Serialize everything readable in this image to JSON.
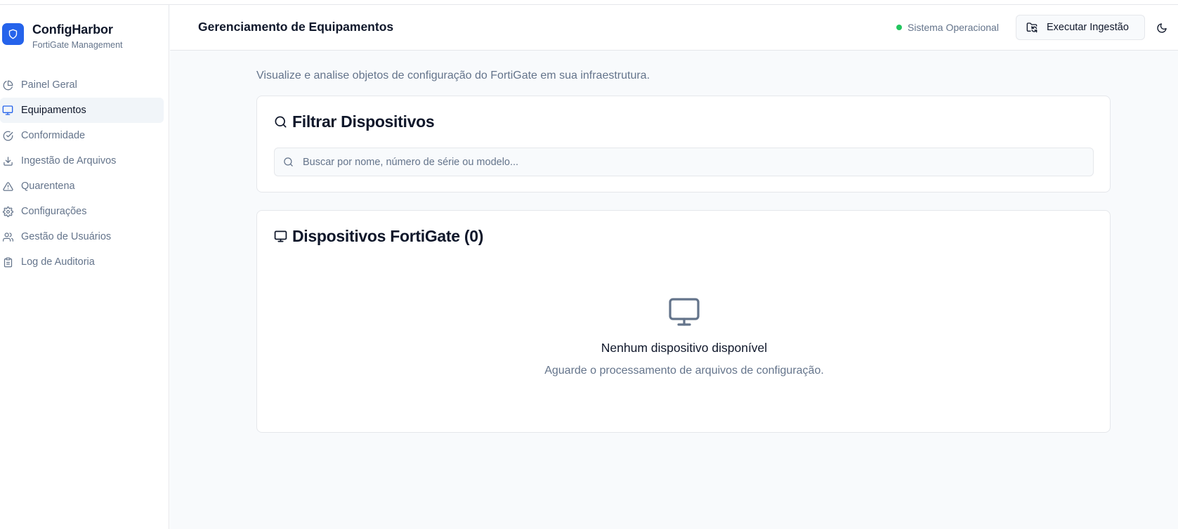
{
  "brand": {
    "title": "ConfigHarbor",
    "subtitle": "FortiGate Management"
  },
  "sidebar": {
    "items": [
      {
        "label": "Painel Geral",
        "icon": "pie-chart-icon",
        "active": false
      },
      {
        "label": "Equipamentos",
        "icon": "monitor-icon",
        "active": true
      },
      {
        "label": "Conformidade",
        "icon": "check-circle-icon",
        "active": false
      },
      {
        "label": "Ingestão de Arquivos",
        "icon": "download-icon",
        "active": false
      },
      {
        "label": "Quarentena",
        "icon": "alert-triangle-icon",
        "active": false
      },
      {
        "label": "Configurações",
        "icon": "gear-icon",
        "active": false
      },
      {
        "label": "Gestão de Usuários",
        "icon": "users-icon",
        "active": false
      },
      {
        "label": "Log de Auditoria",
        "icon": "clipboard-icon",
        "active": false
      }
    ]
  },
  "header": {
    "title": "Gerenciamento de Equipamentos",
    "status": "Sistema Operacional",
    "run_button": "Executar Ingestão"
  },
  "main": {
    "subtitle": "Visualize e analise objetos de configuração do FortiGate em sua infraestrutura.",
    "filter": {
      "title": "Filtrar Dispositivos",
      "placeholder": "Buscar por nome, número de série ou modelo..."
    },
    "devices": {
      "title": "Dispositivos FortiGate (0)",
      "empty_title": "Nenhum dispositivo disponível",
      "empty_desc": "Aguarde o processamento de arquivos de configuração."
    }
  },
  "colors": {
    "accent": "#2563eb",
    "status_ok": "#22c55e",
    "muted_text": "#64748b",
    "background": "#f8fafc"
  }
}
